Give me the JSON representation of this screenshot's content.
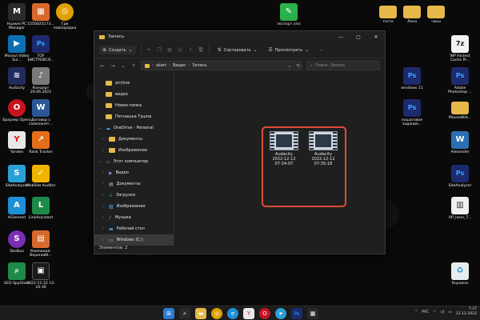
{
  "desktop_icons_left": [
    {
      "id": "huawei",
      "label": "Huawei PC Manager",
      "color": "#2a2a2a",
      "glyph": "M"
    },
    {
      "id": "f1550",
      "label": "1550025173...",
      "color": "#d8692c",
      "glyph": "▦"
    },
    {
      "id": "chrome",
      "label": "Гри повпорядка",
      "color": "#e0a000",
      "glyph": "◎"
    },
    {
      "id": "movavi",
      "label": "Movavi Video Sui...",
      "color": "#0b6fb3",
      "glyph": "▶"
    },
    {
      "id": "ps-tof",
      "label": "TOF БИСТРОВСЯ...",
      "color": "#1d2a6e",
      "glyph": "Ps"
    },
    {
      "id": "audacity",
      "label": "Audacity",
      "color": "#222b5e",
      "glyph": "≋"
    },
    {
      "id": "koncert",
      "label": "Концерт 29.06.2022",
      "color": "#7a7a7a",
      "glyph": "♪"
    },
    {
      "id": "opera",
      "label": "Браузер Opera",
      "color": "#c91220",
      "glyph": "O"
    },
    {
      "id": "dogovor",
      "label": "Договор с самозанят...",
      "color": "#2b5797",
      "glyph": "W"
    },
    {
      "id": "yandex",
      "label": "Yandex",
      "color": "#e8e8e8",
      "glyph": "Y"
    },
    {
      "id": "ranktracker",
      "label": "Rank Tracker",
      "color": "#e46e17",
      "glyph": "↗"
    },
    {
      "id": "siteanalyzer",
      "label": "SiteAnalyzer",
      "color": "#2aa0d6",
      "glyph": "S"
    },
    {
      "id": "websiteauditor",
      "label": "WebSite Auditor",
      "color": "#f0b400",
      "glyph": "✓"
    },
    {
      "id": "aclement",
      "label": "AClement",
      "color": "#1f8fd6",
      "glyph": "A"
    },
    {
      "id": "linkassistant",
      "label": "LinkAssistant",
      "color": "#1e8a4a",
      "glyph": "L"
    },
    {
      "id": "sbolkus",
      "label": "Sbolkus",
      "color": "#7a2fb3",
      "glyph": "S"
    },
    {
      "id": "kompaniya",
      "label": "Компания: Веронойб...",
      "color": "#d8692c",
      "glyph": "▤"
    },
    {
      "id": "seospyglass",
      "label": "SEO SpyGlass",
      "color": "#1e8a4a",
      "glyph": "⌕"
    },
    {
      "id": "date",
      "label": "2022-11-22 12-10-30",
      "color": "#1a1a1a",
      "glyph": "▣"
    }
  ],
  "desktop_icons_right": [
    {
      "id": "greenapp",
      "label": "экспорт.xlsx",
      "color": "#2cb24a",
      "glyph": "✎"
    },
    {
      "id": "testo",
      "label": "тесто",
      "color": "#e7b94a",
      "glyph": ""
    },
    {
      "id": "lena",
      "label": "Лена",
      "color": "#e7b94a",
      "glyph": ""
    },
    {
      "id": "chasy",
      "label": "часы",
      "color": "#e7b94a",
      "glyph": ""
    },
    {
      "id": "7z",
      "label": "WP Fastest Cache Pr...",
      "color": "#f2f2f2",
      "glyph": "7z"
    },
    {
      "id": "ps-win11",
      "label": "windows 11",
      "color": "#1d2a6e",
      "glyph": "Ps"
    },
    {
      "id": "ps-adobe",
      "label": "Adobe Photoshop ...",
      "color": "#1d2a6e",
      "glyph": "Ps"
    },
    {
      "id": "ps-zadanie",
      "label": "пошаговое задание...",
      "color": "#1d2a6e",
      "glyph": "Ps"
    },
    {
      "id": "mouse",
      "label": "MouseWid...",
      "color": "#e7b94a",
      "glyph": ""
    },
    {
      "id": "alexander",
      "label": "Alexander",
      "color": "#2b6fb3",
      "glyph": "W"
    },
    {
      "id": "ps-site",
      "label": "SiteAnalyzer",
      "color": "#1d2a6e",
      "glyph": "Ps"
    },
    {
      "id": "hplaser",
      "label": "HP_laser_T...",
      "color": "#f0f0f0",
      "glyph": "▥"
    },
    {
      "id": "recycle",
      "label": "Корзина",
      "color": "#e6ecef",
      "glyph": "♻"
    }
  ],
  "window": {
    "title": "Запись",
    "toolbar": {
      "new_label": "Создать",
      "sort_label": "Сортировать",
      "view_label": "Просмотреть",
      "more_label": "···"
    },
    "address": {
      "segments": [
        "akart",
        "Видео",
        "Запись"
      ]
    },
    "search_placeholder": "Поиск: Запись",
    "sidebar": [
      {
        "label": "archive",
        "indent": 1,
        "kind": "folder"
      },
      {
        "label": "видео",
        "indent": 1,
        "kind": "folder"
      },
      {
        "label": "Новая папка",
        "indent": 1,
        "kind": "folder"
      },
      {
        "label": "Пятнашка Тушпа",
        "indent": 1,
        "kind": "folder"
      },
      {
        "label": "OneDrive - Personal",
        "indent": 0,
        "kind": "cloud"
      },
      {
        "label": "Документы",
        "indent": 1,
        "kind": "folder"
      },
      {
        "label": "Изображения",
        "indent": 1,
        "kind": "folder"
      },
      {
        "label": "Этот компьютер",
        "indent": 0,
        "kind": "pc"
      },
      {
        "label": "Видео",
        "indent": 1,
        "kind": "video"
      },
      {
        "label": "Документы",
        "indent": 1,
        "kind": "doc"
      },
      {
        "label": "Загрузки",
        "indent": 1,
        "kind": "download"
      },
      {
        "label": "Изображения",
        "indent": 1,
        "kind": "image"
      },
      {
        "label": "Музыка",
        "indent": 1,
        "kind": "music"
      },
      {
        "label": "Рабочий стол",
        "indent": 1,
        "kind": "desktop"
      },
      {
        "label": "Windows (C:)",
        "indent": 1,
        "kind": "drive",
        "selected": true
      }
    ],
    "files": [
      {
        "name": "Audacity",
        "date": "2022-12-12",
        "time": "07-34-07"
      },
      {
        "name": "Audacity",
        "date": "2022-12-12",
        "time": "07-35-18"
      }
    ],
    "status": "Элементов: 2"
  },
  "taskbar": {
    "apps": [
      "windows",
      "search",
      "explorer",
      "chrome",
      "edge",
      "yandex",
      "opera",
      "telegram",
      "photoshop",
      "store"
    ],
    "tray": {
      "lang": "РУС",
      "time": "7:37",
      "date": "12.12.2022"
    }
  },
  "colors": {
    "accent_red": "#e04b36",
    "folder_yellow": "#e7b94a",
    "window_bg": "#1f1f1f"
  }
}
